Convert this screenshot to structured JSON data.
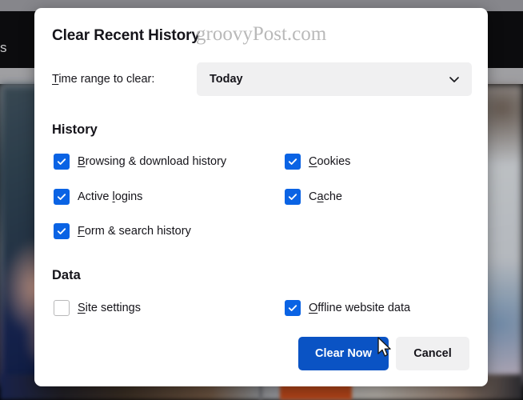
{
  "background": {
    "browser_bar_text": "s"
  },
  "dialog": {
    "title": "Clear Recent History",
    "watermark": "groovyPost.com",
    "time_range": {
      "label_prefix": "T",
      "label_rest": "ime range to clear:",
      "selected": "Today",
      "chevron_icon": "chevron-down-icon"
    },
    "sections": [
      {
        "heading": "History",
        "items": [
          {
            "ak_before": "",
            "ak": "B",
            "ak_after": "rowsing & download history",
            "checked": true,
            "column": "left"
          },
          {
            "ak_before": "",
            "ak": "C",
            "ak_after": "ookies",
            "checked": true,
            "column": "right"
          },
          {
            "ak_before": "Active ",
            "ak": "l",
            "ak_after": "ogins",
            "checked": true,
            "column": "left"
          },
          {
            "ak_before": "C",
            "ak": "a",
            "ak_after": "che",
            "checked": true,
            "column": "right"
          },
          {
            "ak_before": "",
            "ak": "F",
            "ak_after": "orm & search history",
            "checked": true,
            "column": "left"
          }
        ]
      },
      {
        "heading": "Data",
        "items": [
          {
            "ak_before": "",
            "ak": "S",
            "ak_after": "ite settings",
            "checked": false,
            "column": "left"
          },
          {
            "ak_before": "",
            "ak": "O",
            "ak_after": "ffline website data",
            "checked": true,
            "column": "right"
          }
        ]
      }
    ],
    "buttons": {
      "primary": "Clear Now",
      "secondary": "Cancel"
    }
  },
  "colors": {
    "accent_checkbox": "#0a63e4",
    "primary_button": "#0a53c4",
    "secondary_button": "#f0f0f1",
    "dropdown_bg": "#f0f0f1",
    "text": "#15141a",
    "watermark": "#b9b9b9"
  },
  "pointer": {
    "icon": "mouse-cursor-arrow"
  }
}
